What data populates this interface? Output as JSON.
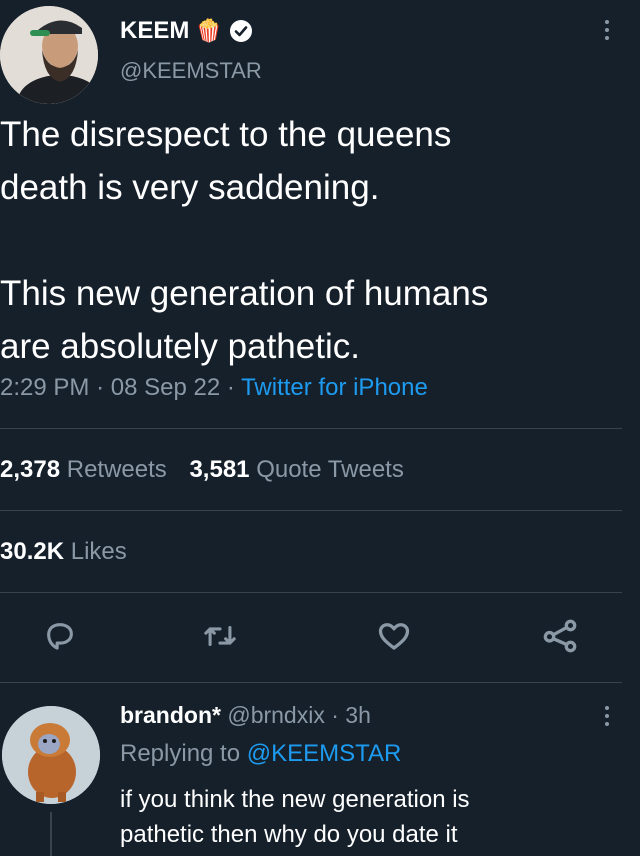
{
  "tweet": {
    "author_name": "KEEM",
    "emoji": "🍿",
    "handle": "@KEEMSTAR",
    "text_line1": "The disrespect to the queens",
    "text_line2": "death is very saddening.",
    "text_line3": "This new generation of humans",
    "text_line4": "are absolutely pathetic.",
    "time": "2:29 PM",
    "date": "08 Sep 22",
    "sep": "·",
    "source": "Twitter for iPhone"
  },
  "stats": {
    "retweets_count": "2,378",
    "retweets_label": "Retweets",
    "quotes_count": "3,581",
    "quotes_label": "Quote Tweets",
    "likes_count": "30.2K",
    "likes_label": "Likes"
  },
  "reply": {
    "author_name": "brandon*",
    "handle": "@brndxix",
    "sep": "·",
    "age": "3h",
    "replying_prefix": "Replying to",
    "replying_to": "@KEEMSTAR",
    "text_line1": "if you think the new generation is",
    "text_line2": "pathetic then why do you date it"
  },
  "colors": {
    "background": "#15202b",
    "link": "#1d9bf0",
    "muted": "#8b98a5",
    "divider": "#38444d"
  }
}
